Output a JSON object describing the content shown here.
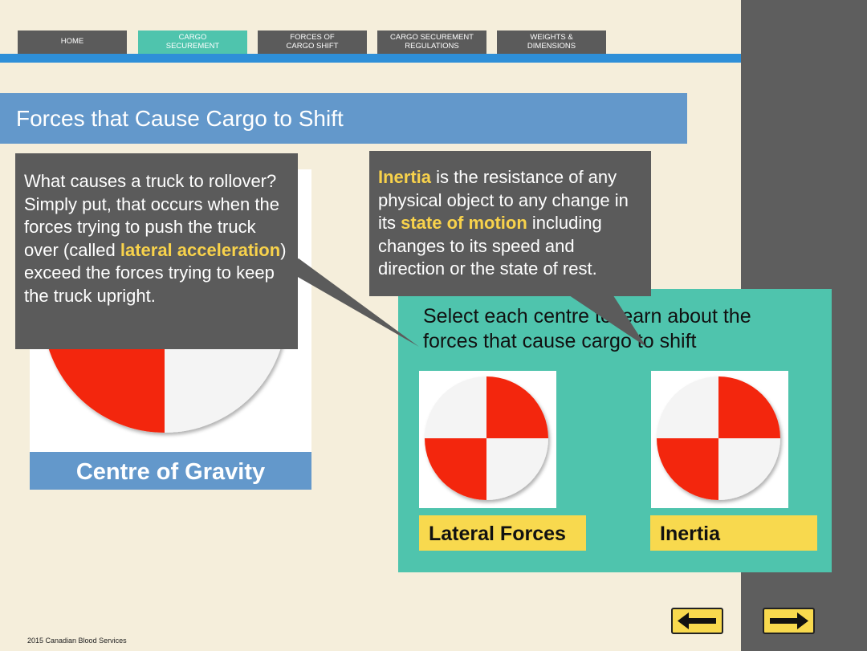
{
  "nav": {
    "tabs": [
      {
        "label": "HOME",
        "active": false
      },
      {
        "label": "CARGO\nSECUREMENT",
        "active": true
      },
      {
        "label": "FORCES OF\nCARGO SHIFT",
        "active": false
      },
      {
        "label": "CARGO SECUREMENT\nREGULATIONS",
        "active": false
      },
      {
        "label": "WEIGHTS &\nDIMENSIONS",
        "active": false
      }
    ]
  },
  "page": {
    "title": "Forces that Cause Cargo to Shift"
  },
  "cog": {
    "caption": "Centre of Gravity"
  },
  "callout_left": {
    "part1": "What causes a truck to rollover? Simply put, that occurs when the forces trying to push the truck over (called ",
    "highlight": "lateral acceleration",
    "part2": ") exceed the forces trying to keep the truck upright."
  },
  "callout_right": {
    "highlight1": "Inertia",
    "part1": " is the resistance of any physical object to any change in its ",
    "highlight2": "state of motion",
    "part2": " including changes to its speed and direction or the state of rest."
  },
  "activity": {
    "instruction": "Select each centre to learn about the forces that cause cargo to shift",
    "options": [
      {
        "label": "Lateral Forces",
        "icon": "centre-of-gravity-icon"
      },
      {
        "label": "Inertia",
        "icon": "centre-of-gravity-icon"
      }
    ]
  },
  "navigation": {
    "back_icon": "arrow-left-icon",
    "next_icon": "arrow-right-icon"
  },
  "footer": {
    "text": "2015 Canadian Blood Services"
  },
  "colors": {
    "accent_teal": "#4fc4ad",
    "banner_blue": "#6398cb",
    "highlight_yellow": "#f8d24b",
    "nav_blue": "#2e8fd8",
    "red": "#f3260a"
  }
}
